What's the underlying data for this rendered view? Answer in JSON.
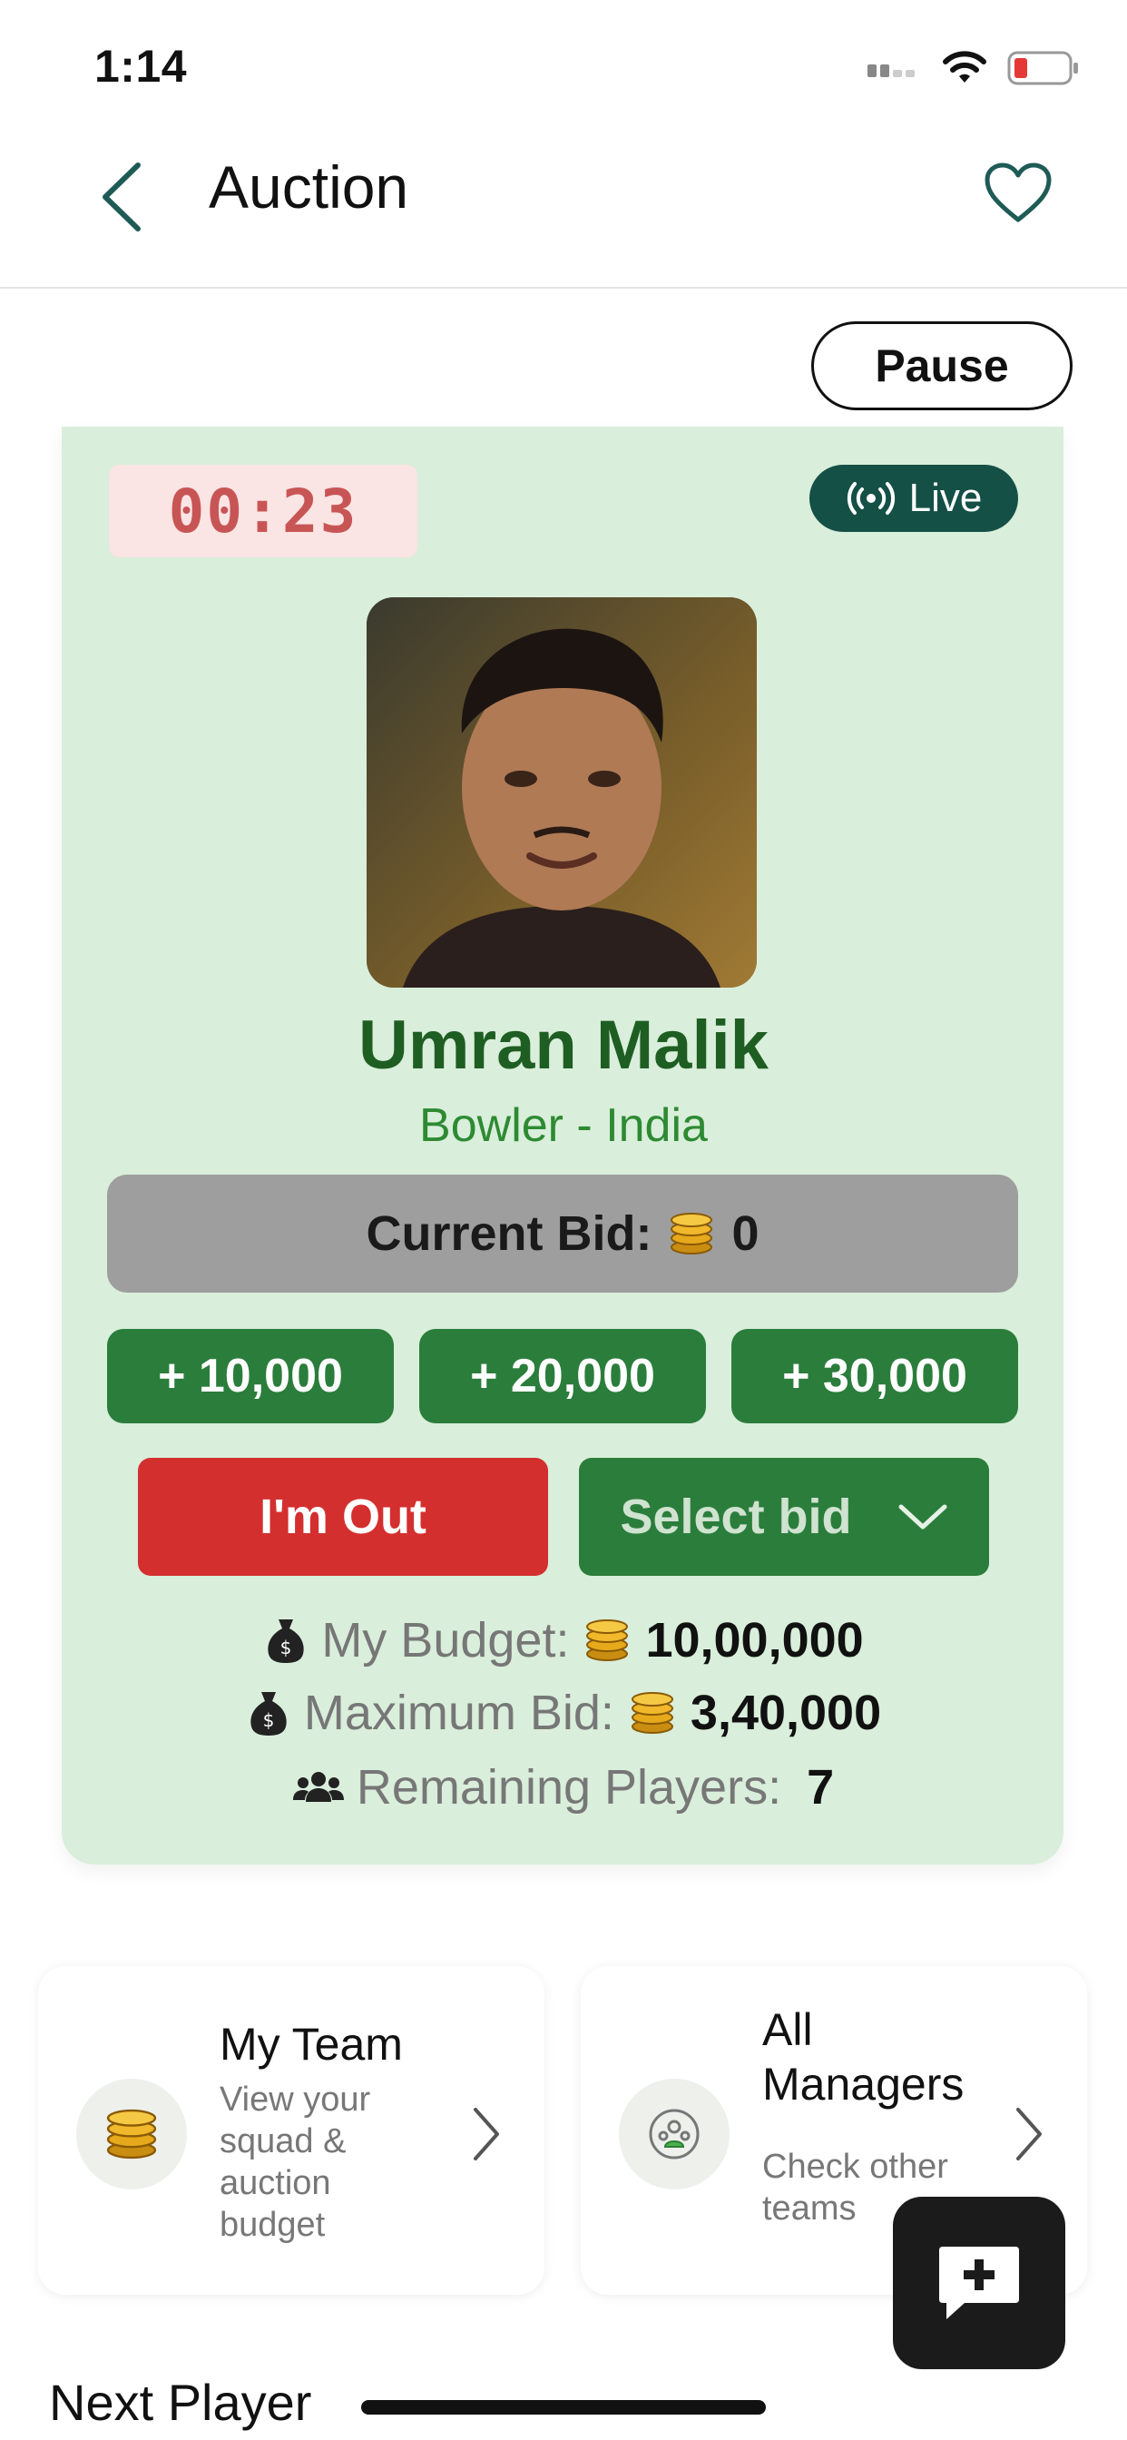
{
  "status": {
    "time": "1:14"
  },
  "nav": {
    "title": "Auction",
    "back_icon": "chevron-left-icon",
    "favorite_icon": "heart-icon"
  },
  "pause_label": "Pause",
  "timer": "00:23",
  "live_label": "Live",
  "player": {
    "name": "Umran Malik",
    "role": "Bowler - India"
  },
  "current_bid": {
    "label": "Current Bid:",
    "value": "0"
  },
  "increments": [
    "+ 10,000",
    "+ 20,000",
    "+ 30,000"
  ],
  "out_label": "I'm Out",
  "select_bid_label": "Select bid",
  "info": {
    "budget_label": "My Budget:",
    "budget_value": "10,00,000",
    "max_bid_label": "Maximum Bid:",
    "max_bid_value": "3,40,000",
    "remaining_label": "Remaining Players:",
    "remaining_value": "7"
  },
  "tiles": [
    {
      "title": "My Team",
      "subtitle": "View your squad & auction budget",
      "icon": "coins-icon"
    },
    {
      "title": "All Managers",
      "subtitle": "Check other teams",
      "icon": "managers-icon"
    }
  ],
  "next_player_label": "Next Player",
  "colors": {
    "primary_green": "#2b7d3b",
    "dark_teal": "#145046",
    "danger_red": "#d42f2f",
    "card_bg": "#d9eedb"
  }
}
